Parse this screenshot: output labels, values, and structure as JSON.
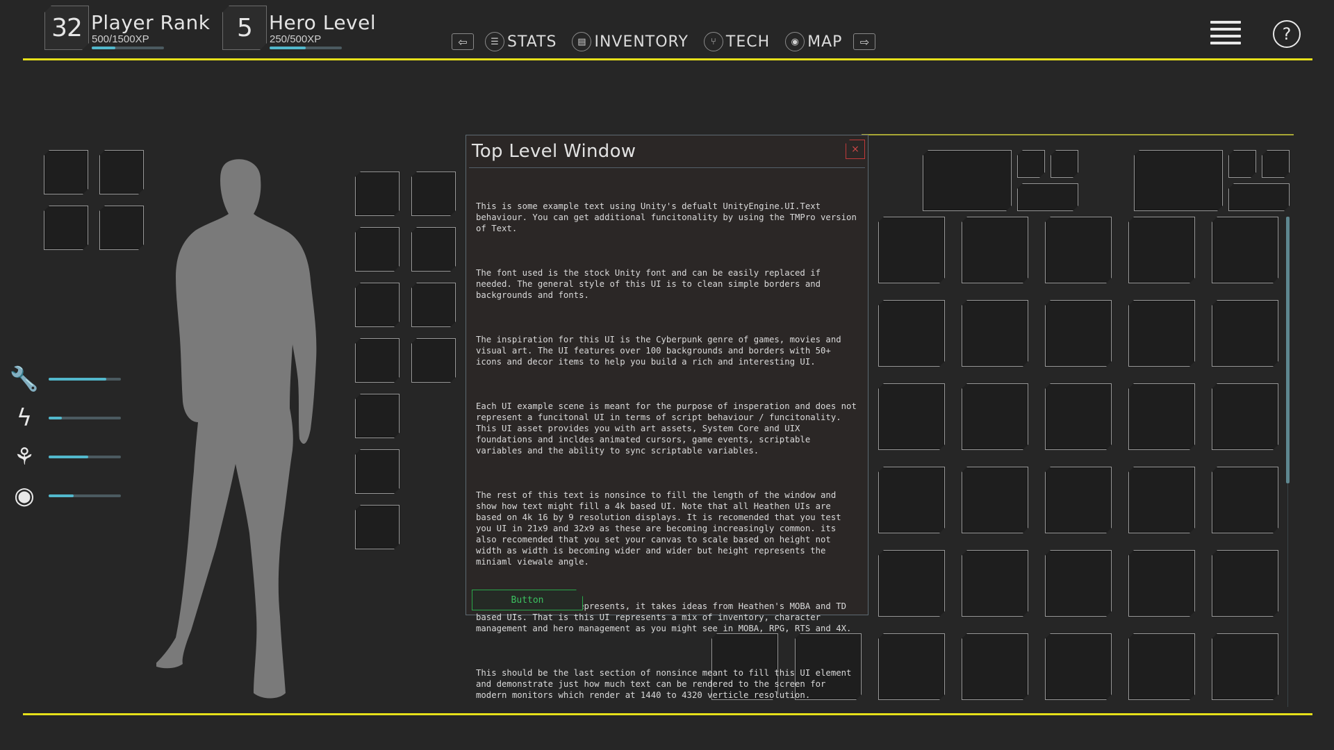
{
  "header": {
    "player_rank": {
      "value": "32",
      "title": "Player Rank",
      "xp": "500/1500XP",
      "progress": 0.33
    },
    "hero_level": {
      "value": "5",
      "title": "Hero Level",
      "xp": "250/500XP",
      "progress": 0.5
    },
    "nav": {
      "prev_icon": "arrow-left-icon",
      "next_icon": "arrow-right-icon",
      "items": [
        {
          "label": "STATS",
          "icon": "list-icon"
        },
        {
          "label": "INVENTORY",
          "icon": "box-icon"
        },
        {
          "label": "TECH",
          "icon": "tech-tree-icon"
        },
        {
          "label": "MAP",
          "icon": "map-pin-icon"
        }
      ]
    },
    "menu_icon": "hamburger-icon",
    "help_label": "?"
  },
  "stats": [
    {
      "icon": "wrench-icon",
      "value": 0.8
    },
    {
      "icon": "lightning-icon",
      "value": 0.18
    },
    {
      "icon": "brain-icon",
      "value": 0.55
    },
    {
      "icon": "eye-icon",
      "value": 0.35
    }
  ],
  "window": {
    "title": "Top Level Window",
    "close_label": "×",
    "paragraphs": [
      "This is some example text using Unity's defualt UnityEngine.UI.Text behaviour. You can get additional funcitonality by using the TMPro version of Text.",
      "The font used is the stock Unity font and can be easily replaced if needed. The general style of this UI is to clean simple borders and backgrounds and fonts.",
      "The inspiration for this UI is the Cyberpunk genre of games, movies and visual art. The UI features over 100 backgrounds and borders with 50+ icons and decor items to help you build a rich and interesting UI.",
      "Each UI example scene is meant for the purpose of insperation and does not represent a funcitonal UI in terms of script behaviour / funcitonality. This UI asset provides you with art assets, System Core and UIX foundations and incldes animated cursors, game events, scriptable variables and the ability to sync scriptable variables.",
      "The rest of this text is nonsince to fill the length of the window and show how text might fill a 4k based UI. Note that all Heathen UIs are based on 4k 16 by 9 resolution displays. It is recomended that you test you UI in 21x9 and 32x9 as these are becoming increasingly common. its also recomended that you set your canvas to scale based on height not width as width is becoming wider and wider but height represents the miniaml viewale angle.",
      "As to what this UI represents, it takes ideas from Heathen's MOBA and TD based UIs. That is this UI represents a mix of inventory, character management and hero management as you might see in MOBA, RPG, RTS and 4X.",
      "This should be the last section of nonsince meant to fill this UI element and demonstrate just how much text can be rendered to the screen for modern monitors which render at 1440 to 4320 verticle resolution."
    ],
    "button_label": "Button"
  },
  "colors": {
    "accent_yellow": "#e6e01a",
    "bar_fill": "#52b8cc",
    "close_red": "#c03a3a",
    "button_green": "#2aa84a"
  }
}
